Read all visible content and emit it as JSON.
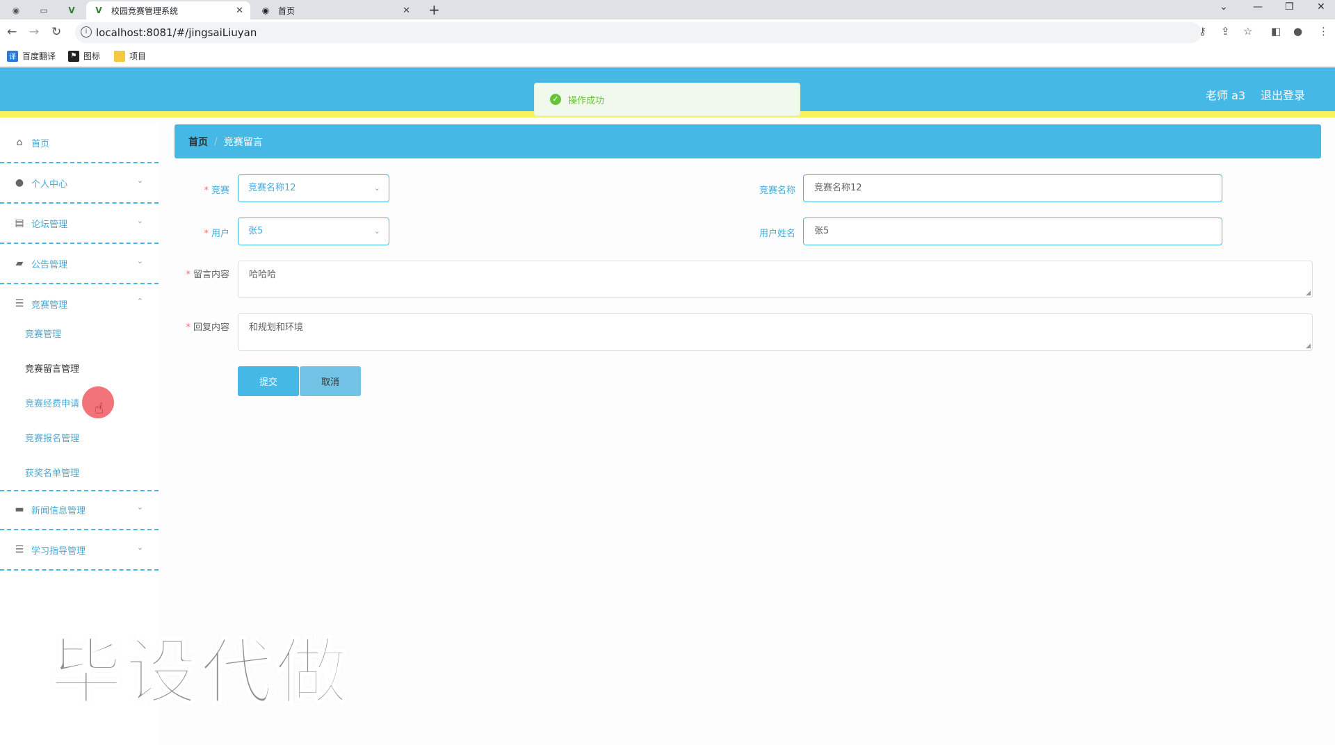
{
  "browser": {
    "tabs": [
      {
        "title": "校园竞赛管理系统"
      },
      {
        "title": "首页"
      }
    ],
    "url": "localhost:8081/#/jingsaiLiuyan",
    "bookmarks": [
      "百度翻译",
      "图标",
      "项目"
    ]
  },
  "header": {
    "user": "老师 a3",
    "logout": "退出登录",
    "toast": "操作成功"
  },
  "sidebar": {
    "home": "首页",
    "personal": "个人中心",
    "forum": "论坛管理",
    "notice": "公告管理",
    "contest": "竞赛管理",
    "sub": [
      "竞赛管理",
      "竞赛留言管理",
      "竞赛经费申请",
      "竞赛报名管理",
      "获奖名单管理"
    ],
    "news": "新闻信息管理",
    "study": "学习指导管理"
  },
  "breadcrumb": {
    "home": "首页",
    "current": "竞赛留言"
  },
  "form": {
    "contest_label": "竞赛",
    "contest_value": "竞赛名称12",
    "contest_name_label": "竞赛名称",
    "contest_name_value": "竞赛名称12",
    "user_label": "用户",
    "user_value": "张5",
    "user_name_label": "用户姓名",
    "user_name_value": "张5",
    "message_label": "留言内容",
    "message_value": "哈哈哈",
    "reply_label": "回复内容",
    "reply_value": "和规划和环境",
    "submit": "提交",
    "cancel": "取消"
  },
  "watermark": "毕设代做",
  "colors": {
    "primary": "#45b8e6",
    "accent_strip": "#f6f35c",
    "success": "#67c23a"
  }
}
